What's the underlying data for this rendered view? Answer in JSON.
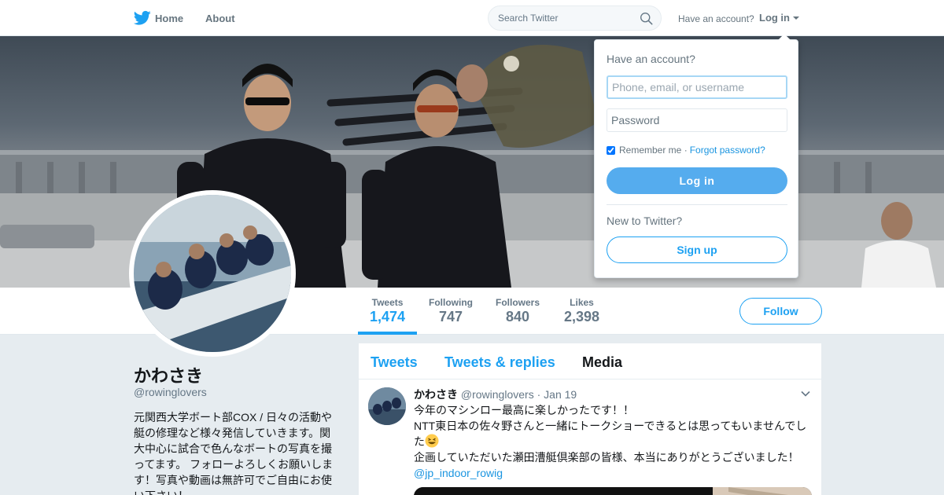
{
  "nav": {
    "home_label": "Home",
    "about_label": "About",
    "search_placeholder": "Search Twitter",
    "have_account_label": "Have an account?",
    "login_label": "Log in"
  },
  "profile": {
    "name": "かわさき",
    "handle": "@rowinglovers",
    "bio": "元関西大学ボート部COX / 日々の活動や艇の修理など様々発信していきます。関大中心に試合で色んなボートの写真を撮ってます。 フォローよろしくお願いします！写真や動画は無許可でご自由にお使い下さい！",
    "follow_label": "Follow"
  },
  "stats": [
    {
      "label": "Tweets",
      "value": "1,474",
      "active": true
    },
    {
      "label": "Following",
      "value": "747",
      "active": false
    },
    {
      "label": "Followers",
      "value": "840",
      "active": false
    },
    {
      "label": "Likes",
      "value": "2,398",
      "active": false
    }
  ],
  "timeline": {
    "tabs": [
      {
        "label": "Tweets",
        "current": false
      },
      {
        "label": "Tweets & replies",
        "current": false
      },
      {
        "label": "Media",
        "current": true
      }
    ],
    "tweet": {
      "name": "かわさき",
      "handle": "@rowinglovers",
      "date": "Jan 19",
      "line1": "今年のマシンロー最高に楽しかったです！！",
      "line2": "NTT東日本の佐々野さんと一緒にトークショーできるとは思ってもいませんでした",
      "line3": "企画していただいた瀬田漕艇倶楽部の皆様、本当にありがとうございました！",
      "mention": "@jp_indoor_rowig"
    }
  },
  "login_dropdown": {
    "title": "Have an account?",
    "username_placeholder": "Phone, email, or username",
    "password_placeholder": "Password",
    "remember_label": "Remember me",
    "forgot_label": "Forgot password?",
    "remember_checked": true,
    "login_button": "Log in",
    "new_label": "New to Twitter?",
    "signup_button": "Sign up"
  },
  "colors": {
    "accent": "#1da1f2",
    "login_button": "#55acee",
    "link": "#1b95e0"
  }
}
